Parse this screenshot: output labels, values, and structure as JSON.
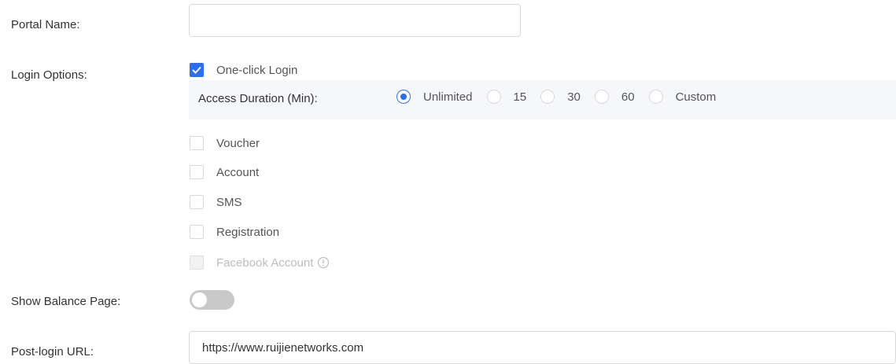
{
  "form": {
    "portal_name": {
      "label": "Portal Name:",
      "value": ""
    },
    "login_options": {
      "label": "Login Options:",
      "one_click": {
        "label": "One-click Login",
        "checked": true
      },
      "access_duration": {
        "label": "Access Duration (Min):",
        "selected": "Unlimited",
        "options": [
          "Unlimited",
          "15",
          "30",
          "60",
          "Custom"
        ]
      },
      "voucher": {
        "label": "Voucher",
        "checked": false
      },
      "account": {
        "label": "Account",
        "checked": false
      },
      "sms": {
        "label": "SMS",
        "checked": false
      },
      "registration": {
        "label": "Registration",
        "checked": false
      },
      "facebook": {
        "label": "Facebook Account",
        "checked": false,
        "disabled": true,
        "info_icon": "info-circle-icon"
      }
    },
    "balance_page": {
      "label": "Show Balance Page:",
      "enabled": false
    },
    "post_login_url": {
      "label": "Post-login URL:",
      "value": "https://www.ruijienetworks.com"
    }
  },
  "colors": {
    "accent": "#2b6ef3",
    "toggle_off": "#c9c9c9",
    "panel_bg": "#f5f7fa",
    "disabled_text": "#bdbdbd"
  }
}
